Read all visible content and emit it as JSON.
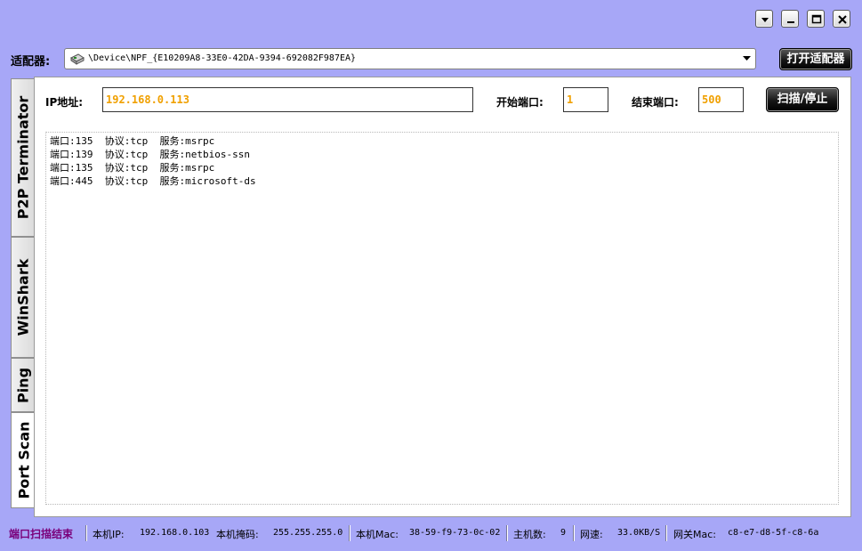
{
  "window": {
    "controls": [
      {
        "name": "menu-dropdown",
        "icon": "chevron-down-icon"
      },
      {
        "name": "minimize",
        "icon": "minimize-icon"
      },
      {
        "name": "maximize",
        "icon": "maximize-icon"
      },
      {
        "name": "close",
        "icon": "close-icon"
      }
    ]
  },
  "adapter": {
    "label": "适配器:",
    "selected": "\\Device\\NPF_{E10209A8-33E0-42DA-9394-692082F987EA}",
    "open_button": "打开适配器",
    "icon": "network-card-icon"
  },
  "tabs": [
    {
      "label": "P2P Terminator",
      "active": false
    },
    {
      "label": "WinShark",
      "active": false
    },
    {
      "label": "Ping",
      "active": false
    },
    {
      "label": "Port Scan",
      "active": true
    }
  ],
  "scan": {
    "ip_label": "IP地址:",
    "ip_value": "192.168.0.113",
    "start_port_label": "开始端口:",
    "start_port_value": "1",
    "end_port_label": "结束端口:",
    "end_port_value": "500",
    "scan_button": "扫描/停止",
    "results": [
      "端口:135  协议:tcp  服务:msrpc",
      "端口:139  协议:tcp  服务:netbios-ssn",
      "端口:135  协议:tcp  服务:msrpc",
      "端口:445  协议:tcp  服务:microsoft-ds"
    ]
  },
  "status": {
    "state": "端口扫描结束",
    "local_ip_label": "本机IP:",
    "local_ip": "192.168.0.103",
    "mask_label": "本机掩码:",
    "mask": "255.255.255.0",
    "mac_label": "本机Mac:",
    "mac": "38-59-f9-73-0c-02",
    "hosts_label": "主机数:",
    "hosts": "9",
    "speed_label": "网速:",
    "speed": "33.0KB/S",
    "gateway_mac_label": "网关Mac:",
    "gateway_mac": "c8-e7-d8-5f-c8-6a"
  },
  "colors": {
    "background": "#a7a7f7",
    "input_text": "#f0a000",
    "status_state": "#7a007a"
  }
}
